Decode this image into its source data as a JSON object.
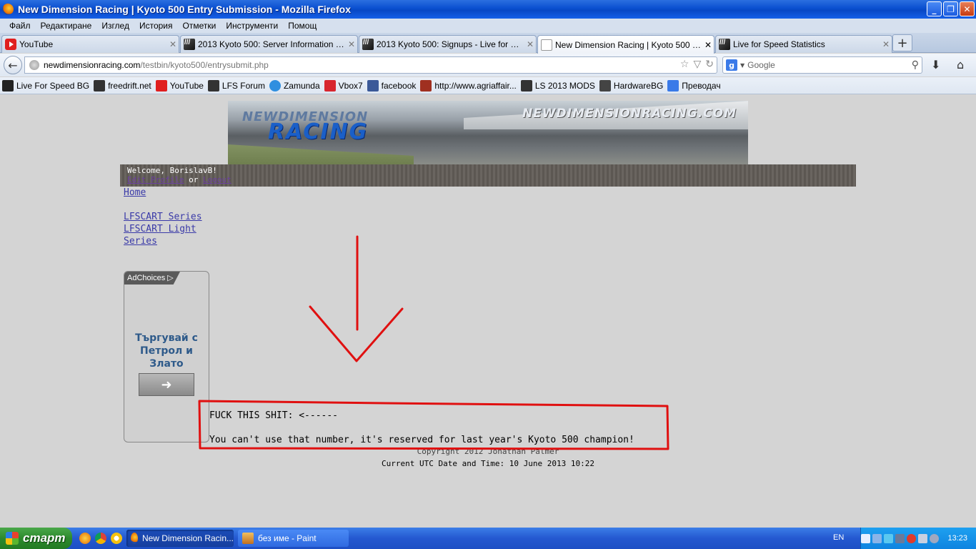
{
  "window": {
    "title": "New Dimension Racing | Kyoto 500 Entry Submission - Mozilla Firefox"
  },
  "menu": [
    "Файл",
    "Редактиране",
    "Изглед",
    "История",
    "Отметки",
    "Инструменти",
    "Помощ"
  ],
  "tabs": [
    {
      "label": "YouTube",
      "icon": "youtube-icon",
      "active": false
    },
    {
      "label": "2013 Kyoto 500: Server Information and ...",
      "icon": "lfs-icon",
      "active": false
    },
    {
      "label": "2013 Kyoto 500: Signups - Live for Speed",
      "icon": "lfs-icon",
      "active": false
    },
    {
      "label": "New Dimension Racing | Kyoto 500 Entry ...",
      "icon": "blank-page-icon",
      "active": true
    },
    {
      "label": "Live for Speed Statistics",
      "icon": "lfs-icon",
      "active": false
    }
  ],
  "address": {
    "domain": "newdimensionracing.com",
    "path": "/testbin/kyoto500/entrysubmit.php"
  },
  "search": {
    "placeholder": "Google"
  },
  "bookmarks": [
    {
      "label": "Live For Speed BG",
      "color": "#222222"
    },
    {
      "label": "freedrift.net",
      "color": "#333333"
    },
    {
      "label": "YouTube",
      "color": "#e01f1f"
    },
    {
      "label": "LFS Forum",
      "color": "#333333"
    },
    {
      "label": "Zamunda",
      "color": "#2f8fe0"
    },
    {
      "label": "Vbox7",
      "color": "#d8262e"
    },
    {
      "label": "facebook",
      "color": "#3b5998"
    },
    {
      "label": "http://www.agriaffair...",
      "color": "#a03020"
    },
    {
      "label": "LS 2013 MODS",
      "color": "#333333"
    },
    {
      "label": "HardwareBG",
      "color": "#444444"
    },
    {
      "label": "Преводач",
      "color": "#3a7ae8"
    }
  ],
  "banner": {
    "logo_top": "NEWDIMENSION",
    "logo_bottom": "RACING",
    "site": "NEWDIMENSIONRACING.COM"
  },
  "welcome": {
    "text": "Welcome, BorislavB!",
    "edit_profile": "Edit Profile",
    "or": " or ",
    "logout": "Logout"
  },
  "nav": {
    "home": "Home",
    "series1": "LFSCART Series",
    "series2_line1": "LFSCART Light",
    "series2_line2": "Series"
  },
  "ad": {
    "choices": "AdChoices",
    "line1": "Търгувай с",
    "line2": "Петрол и",
    "line3": "Злато"
  },
  "message": {
    "line1": "FUCK THIS SHIT: <------",
    "line2": "You can't use that number, it's reserved for last year's Kyoto 500 champion!"
  },
  "footer": {
    "copyright": "Copyright 2012 Jonathan Palmer",
    "datetime": "Current UTC Date and Time: 10 June 2013 10:22"
  },
  "taskbar": {
    "start": "старт",
    "tasks": [
      {
        "label": "New Dimension Racin...",
        "active": true
      },
      {
        "label": "без име - Paint",
        "active": false
      }
    ],
    "lang": "EN",
    "clock": "13:23"
  },
  "colors": {
    "annotation": "#e01010",
    "link": "#3a3aa8"
  }
}
